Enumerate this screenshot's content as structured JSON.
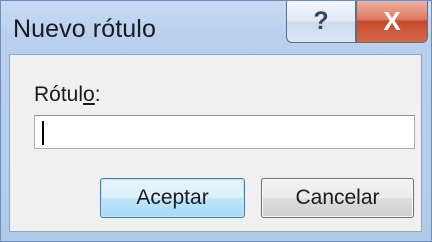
{
  "window": {
    "title": "Nuevo rótulo",
    "help_glyph": "?",
    "close_glyph": "X"
  },
  "form": {
    "label_before": "Rótul",
    "label_mnemonic": "o",
    "label_after": ":",
    "value": ""
  },
  "buttons": {
    "accept": "Aceptar",
    "cancel": "Cancelar"
  }
}
